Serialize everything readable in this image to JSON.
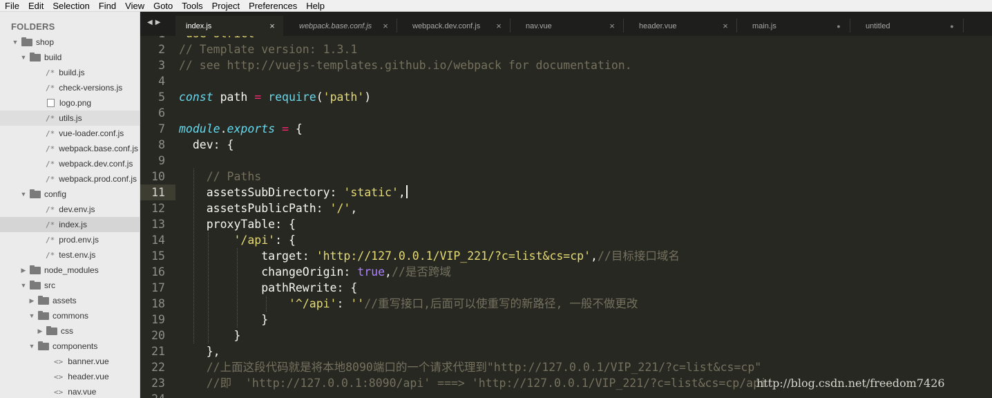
{
  "menu": [
    "File",
    "Edit",
    "Selection",
    "Find",
    "View",
    "Goto",
    "Tools",
    "Project",
    "Preferences",
    "Help"
  ],
  "sidebar": {
    "title": "FOLDERS",
    "items": [
      {
        "label": "shop",
        "type": "folder",
        "depth": 0,
        "open": true
      },
      {
        "label": "build",
        "type": "folder",
        "depth": 1,
        "open": true
      },
      {
        "label": "build.js",
        "type": "js",
        "depth": 2
      },
      {
        "label": "check-versions.js",
        "type": "js",
        "depth": 2
      },
      {
        "label": "logo.png",
        "type": "img",
        "depth": 2
      },
      {
        "label": "utils.js",
        "type": "js",
        "depth": 2,
        "hover": true
      },
      {
        "label": "vue-loader.conf.js",
        "type": "js",
        "depth": 2
      },
      {
        "label": "webpack.base.conf.js",
        "type": "js",
        "depth": 2
      },
      {
        "label": "webpack.dev.conf.js",
        "type": "js",
        "depth": 2
      },
      {
        "label": "webpack.prod.conf.js",
        "type": "js",
        "depth": 2
      },
      {
        "label": "config",
        "type": "folder",
        "depth": 1,
        "open": true
      },
      {
        "label": "dev.env.js",
        "type": "js",
        "depth": 2
      },
      {
        "label": "index.js",
        "type": "js",
        "depth": 2,
        "selected": true
      },
      {
        "label": "prod.env.js",
        "type": "js",
        "depth": 2
      },
      {
        "label": "test.env.js",
        "type": "js",
        "depth": 2
      },
      {
        "label": "node_modules",
        "type": "folder",
        "depth": 1,
        "open": false
      },
      {
        "label": "src",
        "type": "folder",
        "depth": 1,
        "open": true
      },
      {
        "label": "assets",
        "type": "folder",
        "depth": 2,
        "open": false
      },
      {
        "label": "commons",
        "type": "folder",
        "depth": 2,
        "open": true
      },
      {
        "label": "css",
        "type": "folder",
        "depth": 3,
        "open": false
      },
      {
        "label": "components",
        "type": "folder",
        "depth": 2,
        "open": true
      },
      {
        "label": "banner.vue",
        "type": "vue",
        "depth": 3
      },
      {
        "label": "header.vue",
        "type": "vue",
        "depth": 3
      },
      {
        "label": "nav.vue",
        "type": "vue",
        "depth": 3
      }
    ]
  },
  "tabs": [
    {
      "label": "index.js",
      "active": true,
      "italic": false,
      "marker": "close"
    },
    {
      "label": "webpack.base.conf.js",
      "active": false,
      "italic": true,
      "marker": "close"
    },
    {
      "label": "webpack.dev.conf.js",
      "active": false,
      "italic": false,
      "marker": "close"
    },
    {
      "label": "nav.vue",
      "active": false,
      "italic": false,
      "marker": "close"
    },
    {
      "label": "header.vue",
      "active": false,
      "italic": false,
      "marker": "close"
    },
    {
      "label": "main.js",
      "active": false,
      "italic": false,
      "marker": "dirty"
    },
    {
      "label": "untitled",
      "active": false,
      "italic": false,
      "marker": "dirty"
    }
  ],
  "editor": {
    "current_line": 11,
    "watermark": "http://blog.csdn.net/freedom7426",
    "lines": [
      {
        "n": "1",
        "tokens": [
          [
            "str",
            "'use strict'"
          ]
        ]
      },
      {
        "n": "2",
        "tokens": [
          [
            "cm",
            "// Template version: 1.3.1"
          ]
        ]
      },
      {
        "n": "3",
        "tokens": [
          [
            "cm",
            "// see http://vuejs-templates.github.io/webpack for documentation."
          ]
        ]
      },
      {
        "n": "4",
        "tokens": []
      },
      {
        "n": "5",
        "tokens": [
          [
            "kw",
            "const"
          ],
          [
            "pl",
            " path "
          ],
          [
            "op",
            "="
          ],
          [
            "pl",
            " "
          ],
          [
            "fn",
            "require"
          ],
          [
            "pl",
            "("
          ],
          [
            "str",
            "'path'"
          ],
          [
            "pl",
            ")"
          ]
        ]
      },
      {
        "n": "6",
        "tokens": []
      },
      {
        "n": "7",
        "tokens": [
          [
            "kw",
            "module"
          ],
          [
            "pl",
            "."
          ],
          [
            "kw",
            "exports"
          ],
          [
            "pl",
            " "
          ],
          [
            "op",
            "="
          ],
          [
            "pl",
            " {"
          ]
        ]
      },
      {
        "n": "8",
        "tokens": [
          [
            "pl",
            "  dev: {"
          ]
        ]
      },
      {
        "n": "9",
        "tokens": []
      },
      {
        "n": "10",
        "tokens": [
          [
            "pl",
            "    "
          ],
          [
            "cm",
            "// Paths"
          ]
        ]
      },
      {
        "n": "11",
        "tokens": [
          [
            "pl",
            "    assetsSubDirectory: "
          ],
          [
            "str",
            "'static'"
          ],
          [
            "pl",
            ","
          ],
          [
            "caret",
            ""
          ]
        ]
      },
      {
        "n": "12",
        "tokens": [
          [
            "pl",
            "    assetsPublicPath: "
          ],
          [
            "str",
            "'/'"
          ],
          [
            "pl",
            ","
          ]
        ]
      },
      {
        "n": "13",
        "tokens": [
          [
            "pl",
            "    proxyTable: {"
          ]
        ]
      },
      {
        "n": "14",
        "tokens": [
          [
            "pl",
            "        "
          ],
          [
            "str",
            "'/api'"
          ],
          [
            "pl",
            ": {"
          ]
        ]
      },
      {
        "n": "15",
        "tokens": [
          [
            "pl",
            "            target: "
          ],
          [
            "str",
            "'http://127.0.0.1/VIP_221/?c=list&cs=cp'"
          ],
          [
            "pl",
            ","
          ],
          [
            "cm",
            "//目标接口域名"
          ]
        ]
      },
      {
        "n": "16",
        "tokens": [
          [
            "pl",
            "            changeOrigin: "
          ],
          [
            "num",
            "true"
          ],
          [
            "pl",
            ","
          ],
          [
            "cm",
            "//是否跨域"
          ]
        ]
      },
      {
        "n": "17",
        "tokens": [
          [
            "pl",
            "            pathRewrite: {"
          ]
        ]
      },
      {
        "n": "18",
        "tokens": [
          [
            "pl",
            "                "
          ],
          [
            "str",
            "'^/api'"
          ],
          [
            "pl",
            ": "
          ],
          [
            "str",
            "''"
          ],
          [
            "cm",
            "//重写接口,后面可以使重写的新路径, 一般不做更改"
          ]
        ]
      },
      {
        "n": "19",
        "tokens": [
          [
            "pl",
            "            }"
          ]
        ]
      },
      {
        "n": "20",
        "tokens": [
          [
            "pl",
            "        }"
          ]
        ]
      },
      {
        "n": "21",
        "tokens": [
          [
            "pl",
            "    },"
          ]
        ]
      },
      {
        "n": "22",
        "tokens": [
          [
            "pl",
            "    "
          ],
          [
            "cm",
            "//上面这段代码就是将本地8090端口的一个请求代理到\"http://127.0.0.1/VIP_221/?c=list&cs=cp\""
          ]
        ]
      },
      {
        "n": "23",
        "tokens": [
          [
            "pl",
            "    "
          ],
          [
            "cm",
            "//即  'http://127.0.0.1:8090/api' ===> 'http://127.0.0.1/VIP_221/?c=list&cs=cp/api'"
          ]
        ]
      },
      {
        "n": "24",
        "tokens": []
      }
    ]
  }
}
